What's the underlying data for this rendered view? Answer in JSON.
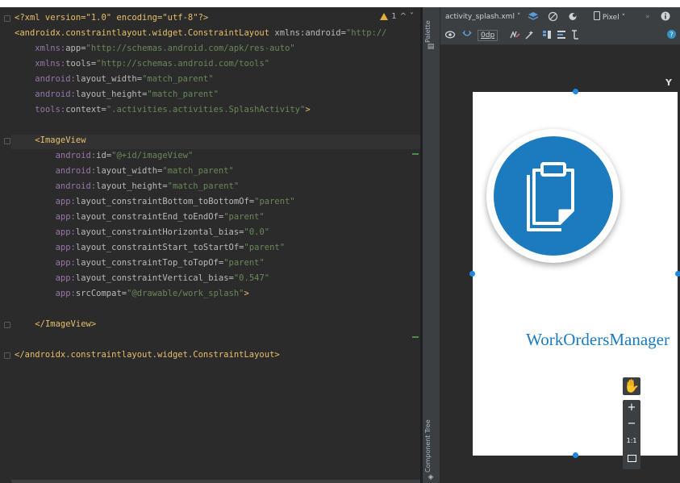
{
  "editor": {
    "warning_count": "1",
    "lines": [
      {
        "kind": "pi",
        "text": "<?xml version=\"1.0\" encoding=\"utf-8\"?>"
      },
      {
        "kind": "root",
        "tag": "<androidx.constraintlayout.widget.ConstraintLayout",
        "attr": " xmlns:android=",
        "val": "\"http://"
      },
      {
        "kind": "attr",
        "indent": "    ",
        "ns": "xmlns:",
        "name": "app",
        "eq": "=",
        "val": "\"http://schemas.android.com/apk/res-auto\""
      },
      {
        "kind": "attr",
        "indent": "    ",
        "ns": "xmlns:",
        "name": "tools",
        "eq": "=",
        "val": "\"http://schemas.android.com/tools\""
      },
      {
        "kind": "attr",
        "indent": "    ",
        "ns": "android:",
        "name": "layout_width",
        "eq": "=",
        "val": "\"match_parent\""
      },
      {
        "kind": "attr",
        "indent": "    ",
        "ns": "android:",
        "name": "layout_height",
        "eq": "=",
        "val": "\"match_parent\""
      },
      {
        "kind": "attr",
        "indent": "    ",
        "ns": "tools:",
        "name": "context",
        "eq": "=",
        "val": "\".activities.activities.SplashActivity\"",
        "tail": ">"
      },
      {
        "kind": "blank"
      },
      {
        "kind": "open",
        "indent": "    ",
        "tag": "<ImageView"
      },
      {
        "kind": "attr",
        "indent": "        ",
        "ns": "android:",
        "name": "id",
        "eq": "=",
        "val": "\"@+id/imageView\""
      },
      {
        "kind": "attr",
        "indent": "        ",
        "ns": "android:",
        "name": "layout_width",
        "eq": "=",
        "val": "\"match_parent\""
      },
      {
        "kind": "attr",
        "indent": "        ",
        "ns": "android:",
        "name": "layout_height",
        "eq": "=",
        "val": "\"match_parent\""
      },
      {
        "kind": "attr",
        "indent": "        ",
        "ns": "app:",
        "name": "layout_constraintBottom_toBottomOf",
        "eq": "=",
        "val": "\"parent\""
      },
      {
        "kind": "attr",
        "indent": "        ",
        "ns": "app:",
        "name": "layout_constraintEnd_toEndOf",
        "eq": "=",
        "val": "\"parent\""
      },
      {
        "kind": "attr",
        "indent": "        ",
        "ns": "app:",
        "name": "layout_constraintHorizontal_bias",
        "eq": "=",
        "val": "\"0.0\""
      },
      {
        "kind": "attr",
        "indent": "        ",
        "ns": "app:",
        "name": "layout_constraintStart_toStartOf",
        "eq": "=",
        "val": "\"parent\""
      },
      {
        "kind": "attr",
        "indent": "        ",
        "ns": "app:",
        "name": "layout_constraintTop_toTopOf",
        "eq": "=",
        "val": "\"parent\""
      },
      {
        "kind": "attr",
        "indent": "        ",
        "ns": "app:",
        "name": "layout_constraintVertical_bias",
        "eq": "=",
        "val": "\"0.547\""
      },
      {
        "kind": "attr",
        "indent": "        ",
        "ns": "app:",
        "name": "srcCompat",
        "eq": "=",
        "val": "\"@drawable/work_splash\"",
        "tail": ">"
      },
      {
        "kind": "blank"
      },
      {
        "kind": "open",
        "indent": "    ",
        "tag": "</ImageView>"
      },
      {
        "kind": "blank"
      },
      {
        "kind": "open",
        "indent": "",
        "tag": "</androidx.constraintlayout.widget.ConstraintLayout>"
      }
    ]
  },
  "side_strip": {
    "palette_label": "Palette",
    "component_tree_label": "Component Tree"
  },
  "design": {
    "file_dropdown": "activity_splash.xml",
    "device_dropdown": "Pixel",
    "margin_value": "0dp",
    "app_name": "WorkOrdersManager",
    "zoom_in": "+",
    "zoom_out": "−",
    "zoom_reset": "1:1"
  },
  "colors": {
    "accent_blue": "#1c7bbf",
    "warning_yellow": "#e0b03a"
  }
}
